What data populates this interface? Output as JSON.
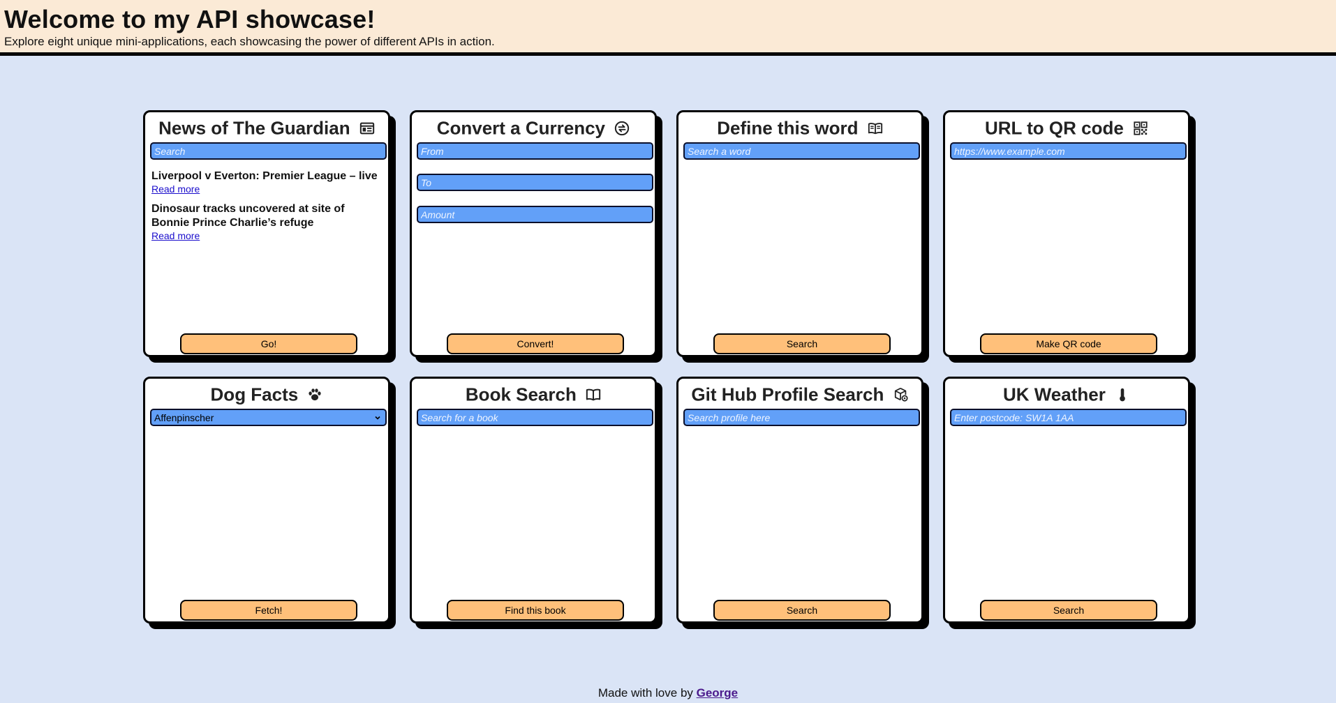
{
  "header": {
    "title": "Welcome to my API showcase!",
    "subtitle": "Explore eight unique mini-applications, each showcasing the power of different APIs in action."
  },
  "cards": {
    "news": {
      "title": "News of The Guardian",
      "icon": "newspaper-icon",
      "search_placeholder": "Search",
      "articles": [
        {
          "headline": "Liverpool v Everton: Premier League – live",
          "link": "Read more"
        },
        {
          "headline": "Dinosaur tracks uncovered at site of Bonnie Prince Charlie’s refuge",
          "link": "Read more"
        }
      ],
      "button": "Go!"
    },
    "currency": {
      "title": "Convert a Currency",
      "icon": "exchange-icon",
      "from_placeholder": "From",
      "to_placeholder": "To",
      "amount_placeholder": "Amount",
      "button": "Convert!"
    },
    "define": {
      "title": "Define this word",
      "icon": "open-book-icon",
      "search_placeholder": "Search a word",
      "button": "Search"
    },
    "qr": {
      "title": "URL to QR code",
      "icon": "qr-code-icon",
      "url_placeholder": "https://www.example.com",
      "button": "Make QR code"
    },
    "dog": {
      "title": "Dog Facts",
      "icon": "paw-icon",
      "selected_breed": "Affenpinscher",
      "button": "Fetch!"
    },
    "book": {
      "title": "Book Search",
      "icon": "book-icon",
      "search_placeholder": "Search for a book",
      "button": "Find this book"
    },
    "github": {
      "title": "Git Hub Profile Search",
      "icon": "cube-search-icon",
      "search_placeholder": "Search profile here",
      "button": "Search"
    },
    "weather": {
      "title": "UK Weather",
      "icon": "thermometer-icon",
      "postcode_placeholder": "Enter postcode: SW1A 1AA",
      "button": "Search"
    }
  },
  "footer": {
    "text": "Made with love by",
    "author": "George"
  },
  "colors": {
    "background": "#dae4f6",
    "header_bg": "#fbead6",
    "input_bg": "#62a0f8",
    "button_bg": "#ffc07a",
    "link": "#1a0dcc"
  }
}
